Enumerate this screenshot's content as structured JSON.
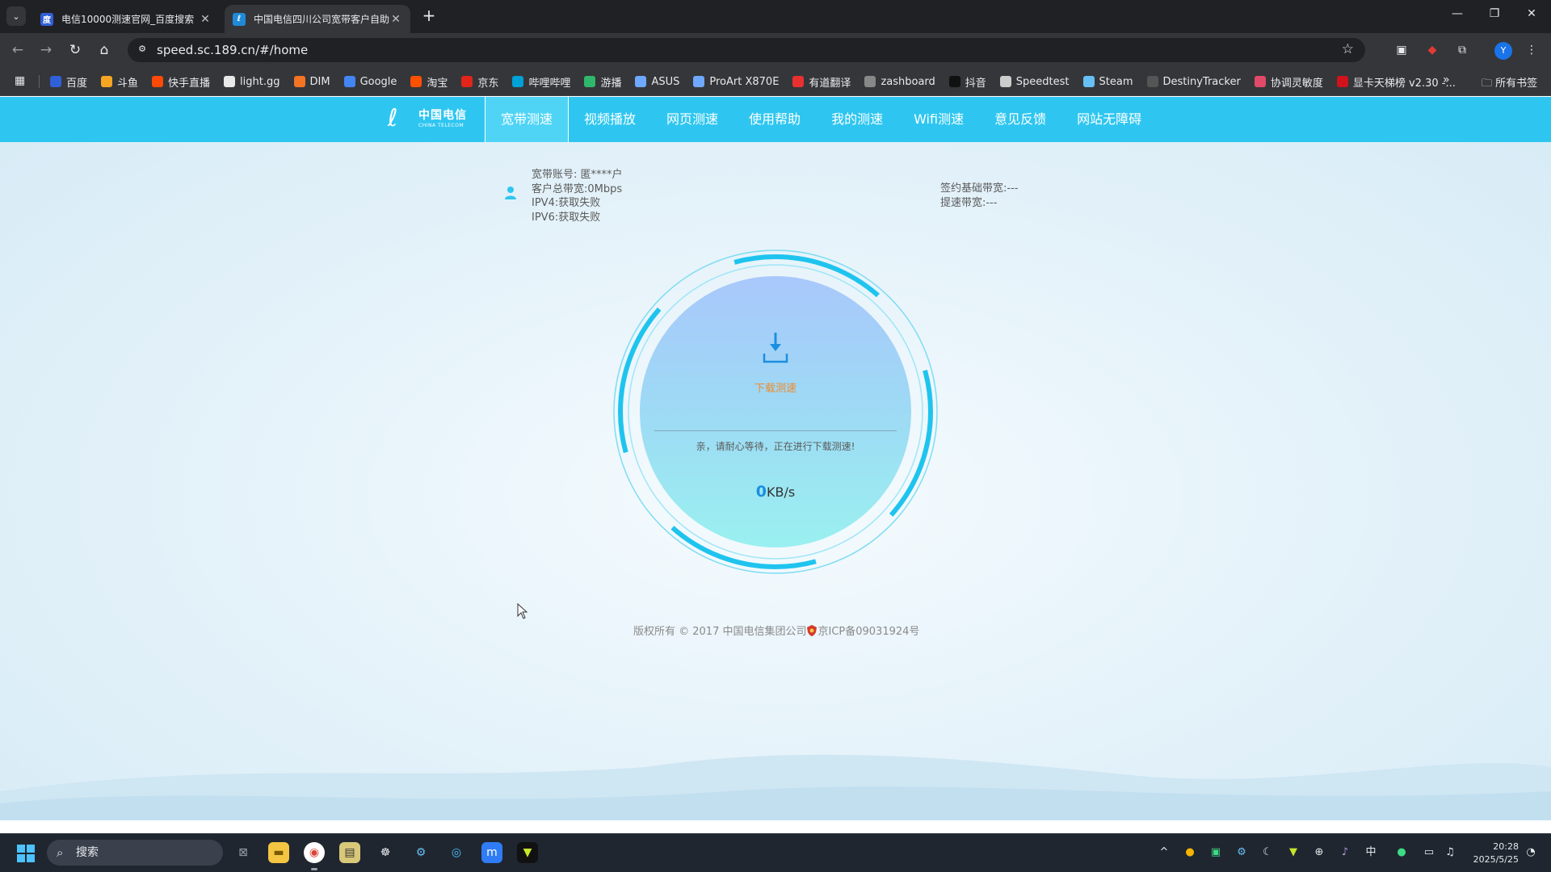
{
  "browser": {
    "tabs": [
      {
        "title": "电信10000测速官网_百度搜索",
        "active": false
      },
      {
        "title": "中国电信四川公司宽带客户自助",
        "active": true
      }
    ],
    "url": "speed.sc.189.cn/#/home",
    "profile_initial": "Y",
    "bookmarks": [
      {
        "label": "百度",
        "icon": "baidu-icon",
        "color": "#3060d8"
      },
      {
        "label": "斗鱼",
        "icon": "douyu-icon",
        "color": "#f5a623"
      },
      {
        "label": "快手直播",
        "icon": "kuaishou-icon",
        "color": "#ff4906"
      },
      {
        "label": "light.gg",
        "icon": "lightgg-icon",
        "color": "#e8e8e8"
      },
      {
        "label": "DIM",
        "icon": "dim-icon",
        "color": "#f37423"
      },
      {
        "label": "Google",
        "icon": "google-icon",
        "color": "#4285f4"
      },
      {
        "label": "淘宝",
        "icon": "taobao-icon",
        "color": "#ff5000"
      },
      {
        "label": "京东",
        "icon": "jd-icon",
        "color": "#e1251b"
      },
      {
        "label": "哔哩哔哩",
        "icon": "bilibili-icon",
        "color": "#00a1d6"
      },
      {
        "label": "游播",
        "icon": "youbo-icon",
        "color": "#2fb86b"
      },
      {
        "label": "ASUS",
        "icon": "asus-icon",
        "color": "#6fa8ff"
      },
      {
        "label": "ProArt X870E",
        "icon": "asus-icon",
        "color": "#6fa8ff"
      },
      {
        "label": "有道翻译",
        "icon": "youdao-icon",
        "color": "#e93030"
      },
      {
        "label": "zashboard",
        "icon": "zashboard-icon",
        "color": "#888888"
      },
      {
        "label": "抖音",
        "icon": "douyin-icon",
        "color": "#111111"
      },
      {
        "label": "Speedtest",
        "icon": "speedtest-icon",
        "color": "#cccccc"
      },
      {
        "label": "Steam",
        "icon": "steam-icon",
        "color": "#66c0f4"
      },
      {
        "label": "DestinyTracker",
        "icon": "destinytracker-icon",
        "color": "#555555"
      },
      {
        "label": "协调灵敏度",
        "icon": "sensitivity-icon",
        "color": "#e24a6a"
      },
      {
        "label": "显卡天梯榜 v2.30 -...",
        "icon": "gpu-ladder-icon",
        "color": "#d0121b"
      }
    ],
    "all_bookmarks_label": "所有书签"
  },
  "site": {
    "logo_cn": "中国电信",
    "logo_en": "CHINA TELECOM",
    "nav": [
      {
        "label": "宽带测速",
        "active": true
      },
      {
        "label": "视频播放",
        "active": false
      },
      {
        "label": "网页测速",
        "active": false
      },
      {
        "label": "使用帮助",
        "active": false
      },
      {
        "label": "我的测速",
        "active": false
      },
      {
        "label": "Wifi测速",
        "active": false
      },
      {
        "label": "意见反馈",
        "active": false
      },
      {
        "label": "网站无障碍",
        "active": false
      }
    ],
    "colors": {
      "nav_bg": "#2ec6f0",
      "accent": "#1fc4ee",
      "label_orange": "#f08c2a"
    }
  },
  "account": {
    "broadband_account": "宽带账号: 匿****户",
    "total_bandwidth": "客户总带宽:0Mbps",
    "ipv4": "IPV4:获取失败",
    "ipv6": "IPV6:获取失败",
    "contract_bandwidth": "签约基础带宽:---",
    "boost_bandwidth": "提速带宽:---"
  },
  "speedtest": {
    "mode_label": "下载测速",
    "wait_message": "亲，请耐心等待，正在进行下载测速!",
    "speed_value": "0",
    "speed_unit": "KB/s"
  },
  "footer": {
    "copyright": "版权所有 © 2017 中国电信集团公司",
    "icp": "京ICP备09031924号"
  },
  "taskbar": {
    "search_placeholder": "搜索",
    "input_method": "中",
    "time": "20:28",
    "date": "2025/5/25"
  }
}
